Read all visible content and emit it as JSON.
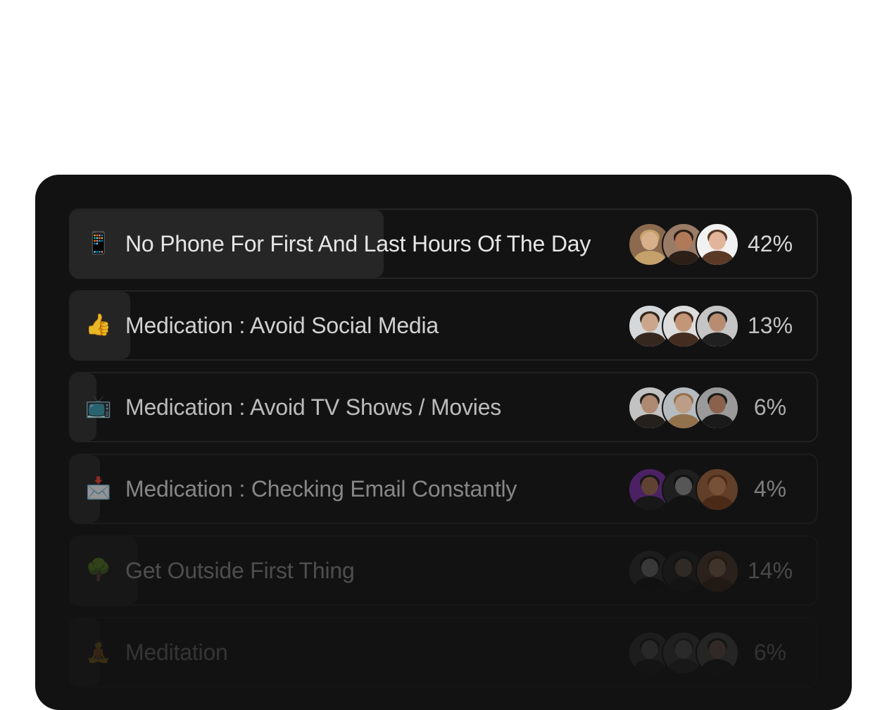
{
  "items": [
    {
      "icon": "mobile-phone-icon",
      "glyph": "📱",
      "label": "No Phone For First And Last Hours Of The Day",
      "percent": "42%",
      "share": 0.42,
      "emphasis": 1.0,
      "avatars": [
        {
          "bg": "#8b6a4f",
          "skin": "#d9b08c",
          "hair": "#c4a06b"
        },
        {
          "bg": "#9a7b66",
          "skin": "#b07a58",
          "hair": "#2b1f18"
        },
        {
          "bg": "#f1f1f1",
          "skin": "#e2b59a",
          "hair": "#5a3a26"
        }
      ]
    },
    {
      "icon": "thumbs-up-icon",
      "glyph": "👍",
      "label": "Medication : Avoid Social Media",
      "percent": "13%",
      "share": 0.08,
      "emphasis": 0.9,
      "avatars": [
        {
          "bg": "#e9eef0",
          "skin": "#e0b79a",
          "hair": "#3b2a20"
        },
        {
          "bg": "#f3f3f3",
          "skin": "#d7a582",
          "hair": "#4a3122"
        },
        {
          "bg": "#d9d9d9",
          "skin": "#c99a7c",
          "hair": "#222222"
        }
      ]
    },
    {
      "icon": "television-icon",
      "glyph": "📺",
      "label": "Medication : Avoid TV Shows / Movies",
      "percent": "6%",
      "share": 0.035,
      "emphasis": 0.8,
      "avatars": [
        {
          "bg": "#eeeeee",
          "skin": "#d6a98a",
          "hair": "#2c241f"
        },
        {
          "bg": "#dfe6ec",
          "skin": "#e7c2a6",
          "hair": "#b5895c"
        },
        {
          "bg": "#bdbdbd",
          "skin": "#a9775b",
          "hair": "#1c1c1c"
        }
      ]
    },
    {
      "icon": "inbox-envelope-icon",
      "glyph": "📩",
      "label": "Medication : Checking Email Constantly",
      "percent": "4%",
      "share": 0.04,
      "emphasis": 0.55,
      "avatars": [
        {
          "bg": "#7a2fa8",
          "skin": "#a06a4e",
          "hair": "#1e1e1e"
        },
        {
          "bg": "#2b2b2b",
          "skin": "#8f8f8f",
          "hair": "#121212"
        },
        {
          "bg": "#a5653c",
          "skin": "#c98657",
          "hair": "#7a3f1d"
        }
      ]
    },
    {
      "icon": "tree-icon",
      "glyph": "🌳",
      "label": "Get Outside First Thing",
      "percent": "14%",
      "share": 0.09,
      "emphasis": 0.28,
      "avatars": [
        {
          "bg": "#3a3a3a",
          "skin": "#9a9a9a",
          "hair": "#111111"
        },
        {
          "bg": "#2a2a2a",
          "skin": "#7d6a5c",
          "hair": "#1a1a1a"
        },
        {
          "bg": "#6b4a36",
          "skin": "#b98a6a",
          "hair": "#4a2c1c"
        }
      ]
    },
    {
      "icon": "meditation-person-icon",
      "glyph": "🧘",
      "label": "Meditation",
      "percent": "6%",
      "share": 0.04,
      "emphasis": 0.16,
      "avatars": [
        {
          "bg": "#5a5a5a",
          "skin": "#9a9a9a",
          "hair": "#222222"
        },
        {
          "bg": "#6a6a6a",
          "skin": "#aaaaaa",
          "hair": "#3a3a3a"
        },
        {
          "bg": "#8a8a8a",
          "skin": "#c9a48a",
          "hair": "#1c1c1c"
        }
      ]
    }
  ]
}
